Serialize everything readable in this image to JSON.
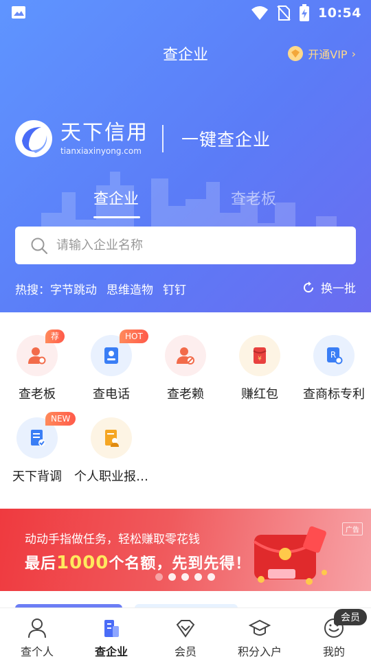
{
  "status_bar": {
    "time": "10:54"
  },
  "header": {
    "title": "查企业",
    "vip_label": "开通VIP"
  },
  "brand": {
    "name": "天下信用",
    "url": "tianxiaxinyong.com",
    "slogan": "一键查企业"
  },
  "tabs": [
    {
      "label": "查企业",
      "active": true
    },
    {
      "label": "查老板",
      "active": false
    }
  ],
  "search": {
    "placeholder": "请输入企业名称"
  },
  "hot_search": {
    "label": "热搜：",
    "items": [
      "字节跳动",
      "思维造物",
      "钉钉"
    ],
    "refresh_label": "换一批"
  },
  "features": [
    {
      "label": "查老板",
      "badge": "荐",
      "icon": "person-search-icon"
    },
    {
      "label": "查电话",
      "badge": "HOT",
      "icon": "contact-card-icon"
    },
    {
      "label": "查老赖",
      "badge": "",
      "icon": "person-ban-icon"
    },
    {
      "label": "赚红包",
      "badge": "",
      "icon": "red-packet-icon"
    },
    {
      "label": "查商标专利",
      "badge": "",
      "icon": "trademark-search-icon"
    },
    {
      "label": "天下背调",
      "badge": "NEW",
      "icon": "checklist-icon"
    },
    {
      "label": "个人职业报…",
      "badge": "",
      "icon": "career-report-icon"
    }
  ],
  "banner": {
    "line1": "动动手指做任务，轻松赚取零花钱",
    "line2_a": "最后",
    "line2_em": "1000",
    "line2_b": "个名额，先到先得！",
    "ad_tag": "广告"
  },
  "bottom_nav": [
    {
      "label": "查个人",
      "active": false
    },
    {
      "label": "查企业",
      "active": true
    },
    {
      "label": "会员",
      "active": false
    },
    {
      "label": "积分入户",
      "active": false
    },
    {
      "label": "我的",
      "active": false
    }
  ],
  "member_badge": "会员",
  "colors": {
    "hero_start": "#5f95ff",
    "hero_end": "#6a6cf0",
    "banner": "#ef3a3f",
    "vip": "#ffd98a",
    "active_nav": "#4a6cf7"
  }
}
